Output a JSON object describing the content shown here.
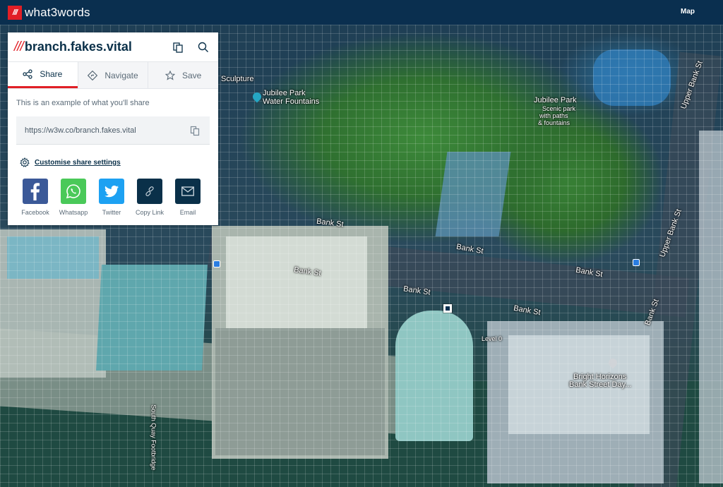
{
  "topbar": {
    "logo_mark": "///",
    "logo_text": "what3words",
    "map_link": "Map"
  },
  "panel": {
    "slashes": "///",
    "address": "branch.fakes.vital",
    "header_icons": [
      "copy-icon",
      "search-icon"
    ],
    "tabs": [
      {
        "label": "Share",
        "icon": "share-icon",
        "active": true
      },
      {
        "label": "Navigate",
        "icon": "navigate-icon",
        "active": false
      },
      {
        "label": "Save",
        "icon": "star-icon",
        "active": false
      }
    ],
    "share_hint": "This is an example of what you'll share",
    "share_url": "https://w3w.co/branch.fakes.vital",
    "customise_label": "Customise share settings",
    "share_options": [
      {
        "label": "Facebook",
        "icon": "facebook-icon",
        "color": "#3b5998"
      },
      {
        "label": "Whatsapp",
        "icon": "whatsapp-icon",
        "color": "#4ac959"
      },
      {
        "label": "Twitter",
        "icon": "twitter-icon",
        "color": "#1da1f2"
      },
      {
        "label": "Copy Link",
        "icon": "link-icon",
        "color": "#0a3049"
      },
      {
        "label": "Email",
        "icon": "envelope-icon",
        "color": "#0a3049"
      }
    ]
  },
  "map": {
    "view": "satellite",
    "labels": {
      "sculpture": "Sculpture",
      "fountains_1": "Jubilee Park",
      "fountains_2": "Water Fountains",
      "park_title": "Jubilee Park",
      "park_desc_1": "Scenic park",
      "park_desc_2": "with paths",
      "park_desc_3": "& fountains",
      "bank_st": "Bank St",
      "upper_bank_st": "Upper Bank St",
      "level": "Level 0",
      "poi_1": "Bright Horizons",
      "poi_2": "Bank Street Day...",
      "footbridge": "South Quay Footbridge"
    }
  },
  "colors": {
    "brand_red": "#e11f26",
    "brand_navy": "#0a2f4f"
  }
}
